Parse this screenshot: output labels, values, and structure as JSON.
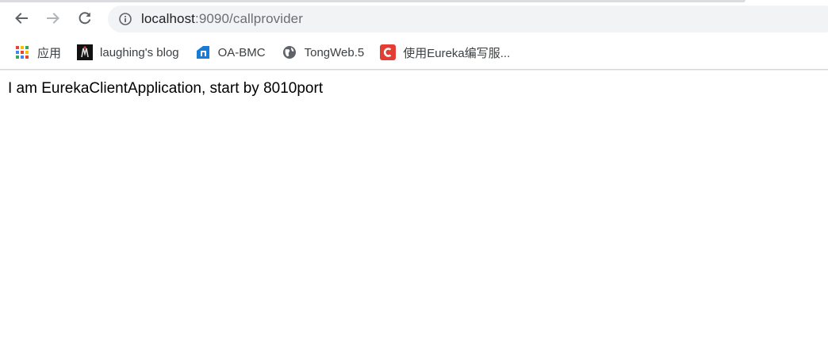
{
  "browser": {
    "address_bar": {
      "host": "localhost",
      "path": ":9090/callprovider"
    },
    "nav_icons": {
      "back": "back-arrow-icon",
      "forward": "forward-arrow-icon",
      "reload": "reload-icon",
      "site_info": "info-icon"
    },
    "bookmarks": [
      {
        "label": "应用",
        "icon": "apps-grid-icon"
      },
      {
        "label": "laughing's blog",
        "icon": "blog-favicon"
      },
      {
        "label": "OA-BMC",
        "icon": "oa-bmc-favicon"
      },
      {
        "label": "TongWeb.5",
        "icon": "globe-icon"
      },
      {
        "label": "使用Eureka编写服...",
        "icon": "csdn-c-favicon"
      }
    ]
  },
  "page": {
    "body_text": "I am EurekaClientApplication, start by 8010port"
  },
  "colors": {
    "omnibox_bg": "#f1f3f4",
    "csdn_red": "#e33e33",
    "oa_blue": "#1a7bd6"
  }
}
